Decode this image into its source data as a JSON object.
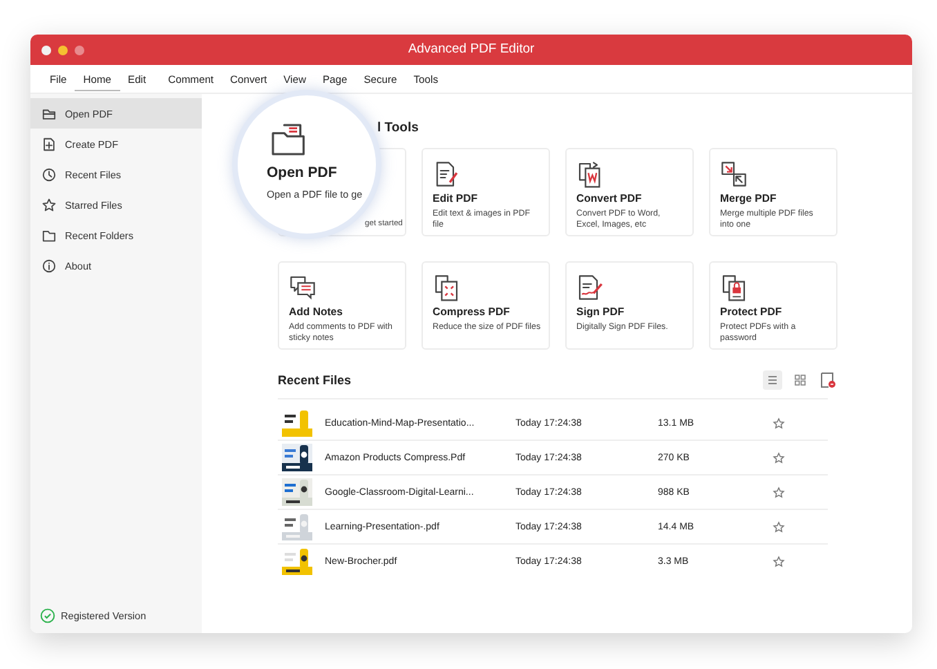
{
  "window": {
    "title": "Advanced PDF Editor"
  },
  "menu": [
    {
      "label": "File",
      "selected": false
    },
    {
      "label": "Home",
      "selected": true
    },
    {
      "label": "Edit",
      "selected": false
    },
    {
      "label": "Comment",
      "selected": false
    },
    {
      "label": "Convert",
      "selected": false
    },
    {
      "label": "View",
      "selected": false
    },
    {
      "label": "Page",
      "selected": false
    },
    {
      "label": "Secure",
      "selected": false
    },
    {
      "label": "Tools",
      "selected": false
    }
  ],
  "sidebar": {
    "items": [
      {
        "label": "Open PDF",
        "selected": true
      },
      {
        "label": "Create PDF",
        "selected": false
      },
      {
        "label": "Recent Files",
        "selected": false
      },
      {
        "label": "Starred Files",
        "selected": false
      },
      {
        "label": "Recent Folders",
        "selected": false
      },
      {
        "label": "About",
        "selected": false
      }
    ],
    "status": "Registered Version"
  },
  "tools": {
    "heading": "l Tools",
    "cards": [
      {
        "description": "get started"
      },
      {
        "title": "Edit PDF",
        "description": "Edit text & images in PDF file"
      },
      {
        "title": "Convert PDF",
        "description": "Convert PDF to Word, Excel, Images, etc"
      },
      {
        "title": "Merge PDF",
        "description": "Merge multiple PDF files into one"
      },
      {
        "title": "Add Notes",
        "description": "Add comments to PDF with sticky notes"
      },
      {
        "title": "Compress PDF",
        "description": "Reduce the size of PDF files"
      },
      {
        "title": "Sign PDF",
        "description": "Digitally Sign PDF Files."
      },
      {
        "title": "Protect PDF",
        "description": "Protect PDFs with a password"
      }
    ]
  },
  "magnifier": {
    "title": "Open PDF",
    "description": "Open a PDF file to ge"
  },
  "recent": {
    "heading": "Recent Files",
    "views": [
      {
        "kind": "list",
        "selected": true
      },
      {
        "kind": "grid",
        "selected": false
      }
    ],
    "rows": [
      {
        "name": "Education-Mind-Map-Presentatio...",
        "date": "Today 17:24:38",
        "size": "13.1 MB",
        "starred": false
      },
      {
        "name": "Amazon Products Compress.Pdf",
        "date": "Today 17:24:38",
        "size": "270 KB",
        "starred": false
      },
      {
        "name": "Google-Classroom-Digital-Learni...",
        "date": "Today 17:24:38",
        "size": "988 KB",
        "starred": false
      },
      {
        "name": "Learning-Presentation-.pdf",
        "date": "Today 17:24:38",
        "size": "14.4 MB",
        "starred": false
      },
      {
        "name": "New-Brocher.pdf",
        "date": "Today 17:24:38",
        "size": "3.3 MB",
        "starred": false
      }
    ]
  }
}
